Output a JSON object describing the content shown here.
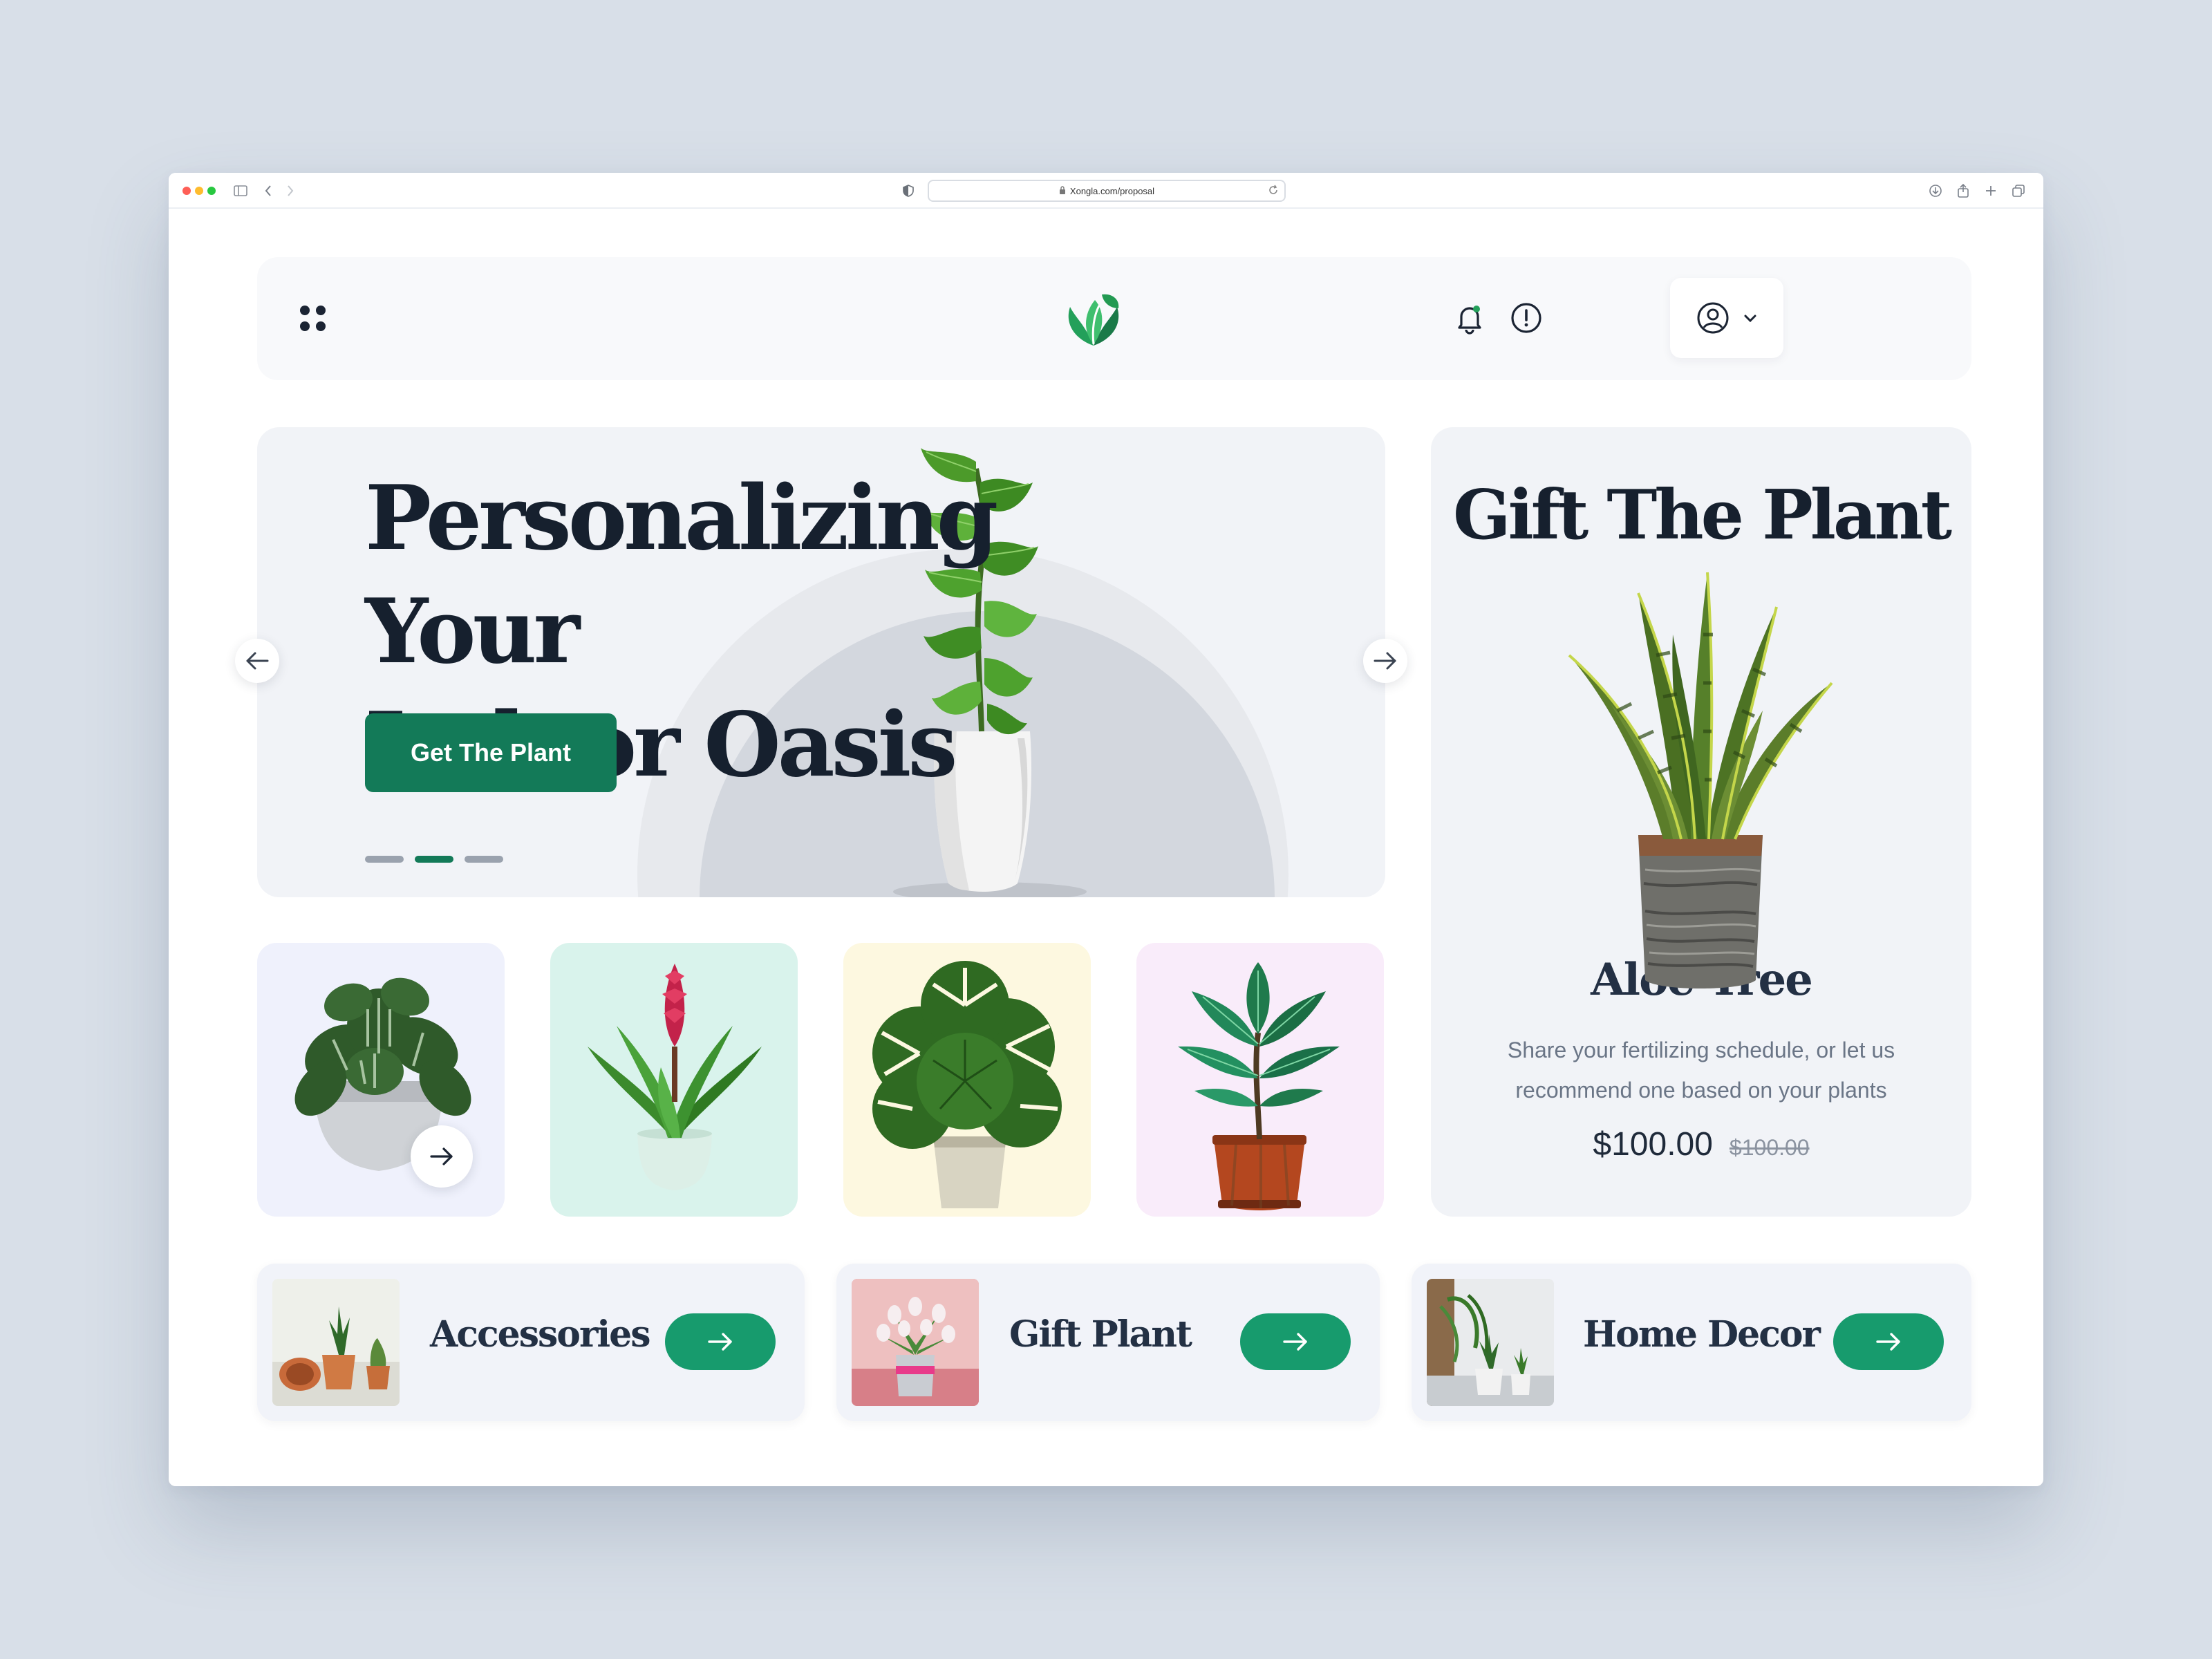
{
  "browser": {
    "url": "Xongla.com/proposal"
  },
  "hero": {
    "title_line1": "Personalizing Your",
    "title_line2": "Indoor Oasis",
    "cta_label": "Get The Plant",
    "slide_index": 2,
    "slide_count": 3
  },
  "gift": {
    "title": "Gift The Plant",
    "name": "Aloe Tree",
    "description": "Share your fertilizing schedule, or let us recommend one based on your plants",
    "price": "$100.00",
    "old_price": "$100.00"
  },
  "categories": [
    {
      "label": "Accessories"
    },
    {
      "label": "Gift Plant"
    },
    {
      "label": "Home Decor"
    }
  ],
  "thumbnails": [
    {
      "icon": "peperomia-plant-icon",
      "bg": "#eff1fc"
    },
    {
      "icon": "bromeliad-plant-icon",
      "bg": "#d9f3ec"
    },
    {
      "icon": "monstera-plant-icon",
      "bg": "#fdf8e0"
    },
    {
      "icon": "rubber-plant-icon",
      "bg": "#f9ecfa"
    }
  ],
  "colors": {
    "brand_green": "#137a58",
    "button_green": "#179b6d",
    "heading": "#16202e",
    "card_bg": "#f1f3f7"
  }
}
